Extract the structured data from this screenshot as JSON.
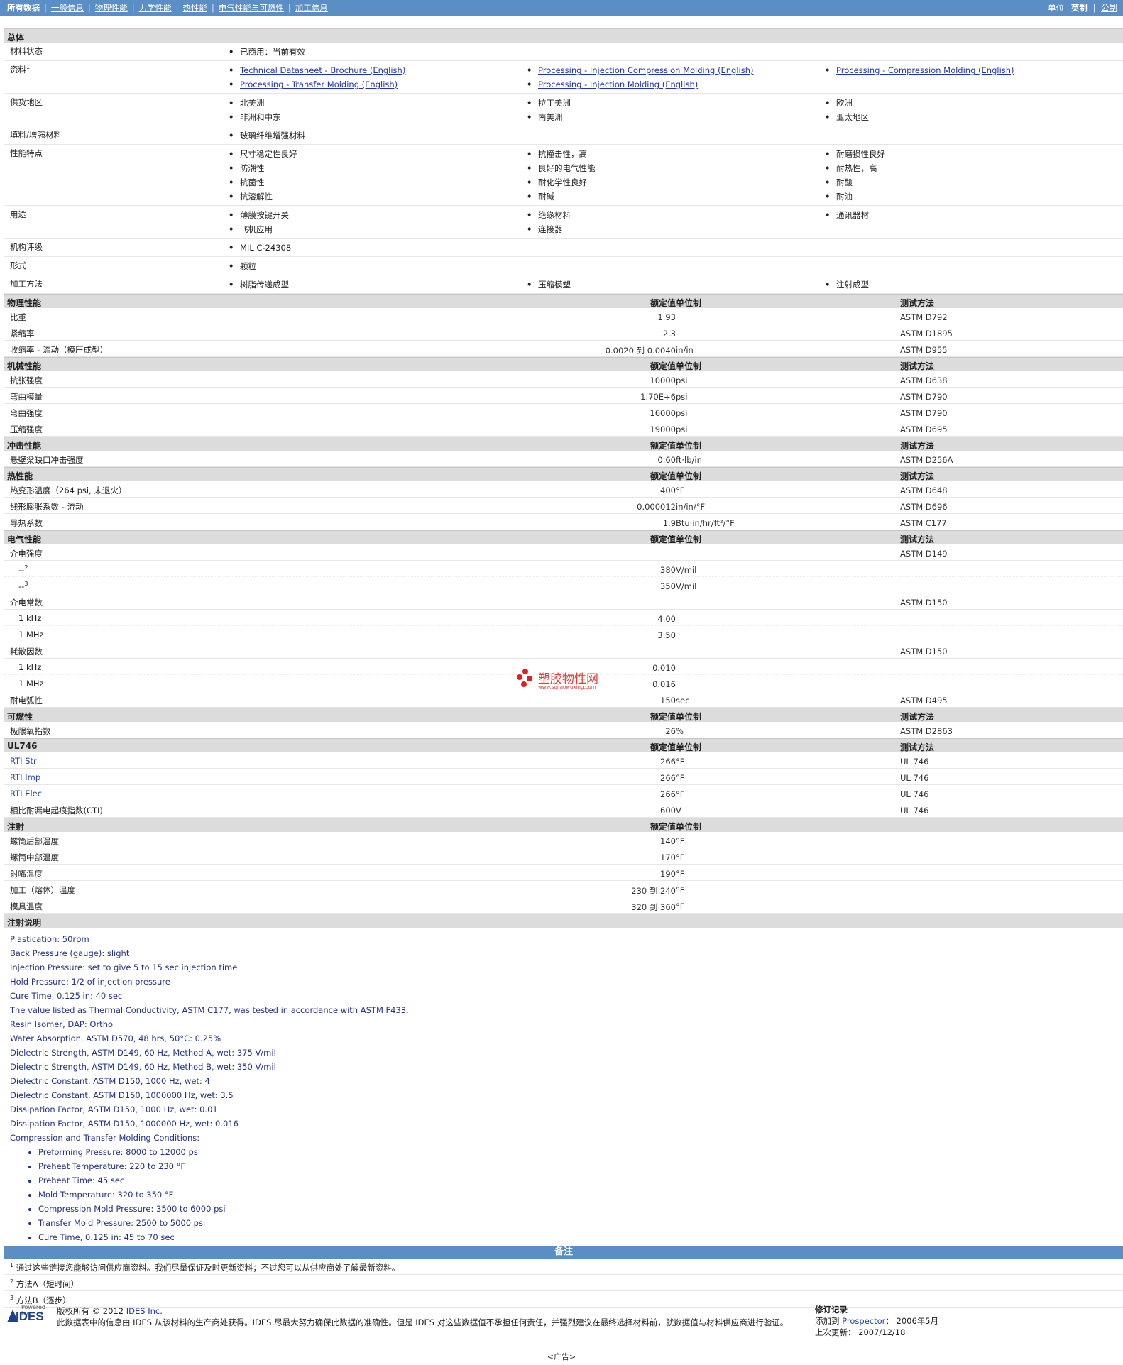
{
  "nav": {
    "items": [
      "所有数据",
      "一般信息",
      "物理性能",
      "力学性能",
      "热性能",
      "电气性能与可燃性",
      "加工信息"
    ],
    "units_label": "单位",
    "units_active": "英制",
    "units_other": "公制"
  },
  "general": {
    "title": "总体",
    "rows": [
      {
        "label": "材料状态",
        "cols": [
          [
            "已商用：当前有效"
          ],
          [],
          []
        ]
      },
      {
        "label": "资料",
        "sup": "1",
        "link": true,
        "cols": [
          [
            "Technical Datasheet - Brochure (English)",
            "Processing - Transfer Molding (English)"
          ],
          [
            "Processing - Injection Compression Molding (English)",
            "Processing - Injection Molding (English)"
          ],
          [
            "Processing - Compression Molding (English)"
          ]
        ]
      },
      {
        "label": "供货地区",
        "cols": [
          [
            "北美洲",
            "非洲和中东"
          ],
          [
            "拉丁美洲",
            "南美洲"
          ],
          [
            "欧洲",
            "亚太地区"
          ]
        ]
      },
      {
        "label": "填料/增强材料",
        "cols": [
          [
            "玻璃纤维增强材料"
          ],
          [],
          []
        ]
      },
      {
        "label": "性能特点",
        "cols": [
          [
            "尺寸稳定性良好",
            "防潮性",
            "抗菌性",
            "抗溶解性"
          ],
          [
            "抗撞击性，高",
            "良好的电气性能",
            "耐化学性良好",
            "耐碱"
          ],
          [
            "耐磨损性良好",
            "耐热性，高",
            "耐酸",
            "耐油"
          ]
        ]
      },
      {
        "label": "用途",
        "cols": [
          [
            "薄膜按键开关",
            "飞机应用"
          ],
          [
            "绝缘材料",
            "连接器"
          ],
          [
            "通讯器材"
          ]
        ]
      },
      {
        "label": "机构评级",
        "cols": [
          [
            "MIL C-24308"
          ],
          [],
          []
        ]
      },
      {
        "label": "形式",
        "cols": [
          [
            "颗粒"
          ],
          [],
          []
        ]
      },
      {
        "label": "加工方法",
        "cols": [
          [
            "树脂传递成型"
          ],
          [
            "压缩模塑"
          ],
          [
            "注射成型"
          ]
        ]
      }
    ]
  },
  "headers": {
    "nominal": "额定值",
    "unit": "单位制",
    "method": "测试方法"
  },
  "sections": [
    {
      "title": "物理性能",
      "show_method": true,
      "rows": [
        {
          "label": "比重",
          "value": "1.93",
          "unit": "",
          "method": "ASTM D792"
        },
        {
          "label": "紧缩率",
          "value": "2.3",
          "unit": "",
          "method": "ASTM D1895"
        },
        {
          "label": "收缩率 - 流动（模压成型）",
          "value": "0.0020 到  0.0040",
          "unit": "in/in",
          "method": "ASTM D955"
        }
      ]
    },
    {
      "title": "机械性能",
      "show_method": true,
      "rows": [
        {
          "label": "抗张强度",
          "value": "10000",
          "unit": "psi",
          "method": "ASTM D638"
        },
        {
          "label": "弯曲模量",
          "value": "1.70E+6",
          "unit": "psi",
          "method": "ASTM D790"
        },
        {
          "label": "弯曲强度",
          "value": "16000",
          "unit": "psi",
          "method": "ASTM D790"
        },
        {
          "label": "压缩强度",
          "value": "19000",
          "unit": "psi",
          "method": "ASTM D695"
        }
      ]
    },
    {
      "title": "冲击性能",
      "show_method": true,
      "rows": [
        {
          "label": "悬壁梁缺口冲击强度",
          "value": "0.60",
          "unit": "ft·lb/in",
          "method": "ASTM D256A"
        }
      ]
    },
    {
      "title": "热性能",
      "show_method": true,
      "rows": [
        {
          "label": "热变形温度（264 psi, 未退火）",
          "value": "400",
          "unit": "°F",
          "method": "ASTM D648"
        },
        {
          "label": "线形膨胀系数 - 流动",
          "value": "0.000012",
          "unit": "in/in/°F",
          "method": "ASTM D696"
        },
        {
          "label": "导热系数",
          "value": "1.9",
          "unit": "Btu·in/hr/ft²/°F",
          "method": "ASTM C177"
        }
      ]
    },
    {
      "title": "电气性能",
      "show_method": true,
      "rows": [
        {
          "label": "介电强度",
          "value": "",
          "unit": "",
          "method": "ASTM D149"
        },
        {
          "label": "--",
          "sup": "2",
          "indent": true,
          "sub": true,
          "value": "380",
          "unit": "V/mil",
          "method": ""
        },
        {
          "label": "--",
          "sup": "3",
          "indent": true,
          "sub": true,
          "value": "350",
          "unit": "V/mil",
          "method": ""
        },
        {
          "label": "介电常数",
          "value": "",
          "unit": "",
          "method": "ASTM D150"
        },
        {
          "label": "1 kHz",
          "indent": true,
          "sub": true,
          "value": "4.00",
          "unit": "",
          "method": ""
        },
        {
          "label": "1 MHz",
          "indent": true,
          "sub": true,
          "value": "3.50",
          "unit": "",
          "method": ""
        },
        {
          "label": "耗散因数",
          "value": "",
          "unit": "",
          "method": "ASTM D150"
        },
        {
          "label": "1 kHz",
          "indent": true,
          "sub": true,
          "value": "0.010",
          "unit": "",
          "method": ""
        },
        {
          "label": "1 MHz",
          "indent": true,
          "sub": true,
          "value": "0.016",
          "unit": "",
          "method": ""
        },
        {
          "label": "耐电弧性",
          "value": "150",
          "unit": "sec",
          "method": "ASTM D495"
        }
      ]
    },
    {
      "title": "可燃性",
      "show_method": true,
      "rows": [
        {
          "label": "极限氧指数",
          "value": "26",
          "unit": "%",
          "method": "ASTM D2863"
        }
      ]
    },
    {
      "title": "UL746",
      "show_method": true,
      "rows": [
        {
          "label": "RTI Str",
          "blue": true,
          "value": "266",
          "unit": "°F",
          "method": "UL 746"
        },
        {
          "label": "RTI Imp",
          "blue": true,
          "value": "266",
          "unit": "°F",
          "method": "UL 746"
        },
        {
          "label": "RTI Elec",
          "blue": true,
          "value": "266",
          "unit": "°F",
          "method": "UL 746"
        },
        {
          "label": "相比耐漏电起痕指数(CTI)",
          "value": "600",
          "unit": "V",
          "method": "UL 746"
        }
      ]
    },
    {
      "title": "注射",
      "show_method": false,
      "rows": [
        {
          "label": "螺筒后部温度",
          "value": "140",
          "unit": "°F",
          "method": ""
        },
        {
          "label": "螺筒中部温度",
          "value": "170",
          "unit": "°F",
          "method": ""
        },
        {
          "label": "射嘴温度",
          "value": "190",
          "unit": "°F",
          "method": ""
        },
        {
          "label": "加工（熔体）温度",
          "value": "230 到  240",
          "unit": "°F",
          "method": ""
        },
        {
          "label": "模具温度",
          "value": "320 到  360",
          "unit": "°F",
          "method": ""
        }
      ]
    }
  ],
  "injection_notes": {
    "title": "注射说明",
    "lines": [
      "Plastication: 50rpm",
      "Back Pressure (gauge): slight",
      "Injection Pressure: set to give 5 to 15 sec injection time",
      "Hold Pressure: 1/2 of injection pressure",
      "Cure Time, 0.125 in: 40 sec",
      "The value listed as Thermal Conductivity, ASTM C177, was tested in accordance with ASTM F433.",
      "Resin Isomer, DAP: Ortho",
      "Water Absorption, ASTM D570, 48 hrs, 50°C: 0.25%",
      "Dielectric Strength, ASTM D149, 60 Hz, Method A, wet: 375 V/mil",
      "Dielectric Strength, ASTM D149, 60 Hz, Method B, wet: 350 V/mil",
      "Dielectric Constant, ASTM D150, 1000 Hz, wet: 4",
      "Dielectric Constant, ASTM D150, 1000000 Hz, wet: 3.5",
      "Dissipation Factor, ASTM D150, 1000 Hz, wet: 0.01",
      "Dissipation Factor, ASTM D150, 1000000 Hz, wet: 0.016",
      "Compression and Transfer Molding Conditions:"
    ],
    "bullets": [
      "Preforming Pressure: 8000 to 12000 psi",
      "Preheat Temperature: 220 to 230 °F",
      "Preheat Time: 45 sec",
      "Mold Temperature: 320 to 350 °F",
      "Compression Mold Pressure: 3500 to 6000 psi",
      "Transfer Mold Pressure: 2500 to 5000 psi",
      "Cure Time, 0.125 in: 45 to 70 sec"
    ]
  },
  "remarks": {
    "title": "备注",
    "items": [
      {
        "sup": "1",
        "text": "通过这些链接您能够访问供应商资料。我们尽量保证及时更新资料；不过您可以从供应商处了解最新资料。"
      },
      {
        "sup": "2",
        "text": "方法A（短时间）"
      },
      {
        "sup": "3",
        "text": "方法B（逐步）"
      }
    ]
  },
  "footer": {
    "logo_powered": "Powered by",
    "logo_text": "IDES",
    "copyright": "版权所有 © 2012",
    "copyright_link": "IDES Inc.",
    "disclaimer": "此数据表中的信息由 IDES 从该材料的生产商处获得。IDES 尽最大努力确保此数据的准确性。但是 IDES 对这些数据值不承担任何责任，并强烈建议在最终选择材料前，就数据值与材料供应商进行验证。",
    "rev_title": "修订记录",
    "added_label": "添加到",
    "added_link": "Prospector",
    "added_date": "2006年5月",
    "updated_label": "上次更新：",
    "updated_date": "2007/12/18"
  },
  "watermark": {
    "cn": "塑胶物性网",
    "url": "www.sujiaowuxing.com"
  },
  "ad": "<广告>"
}
